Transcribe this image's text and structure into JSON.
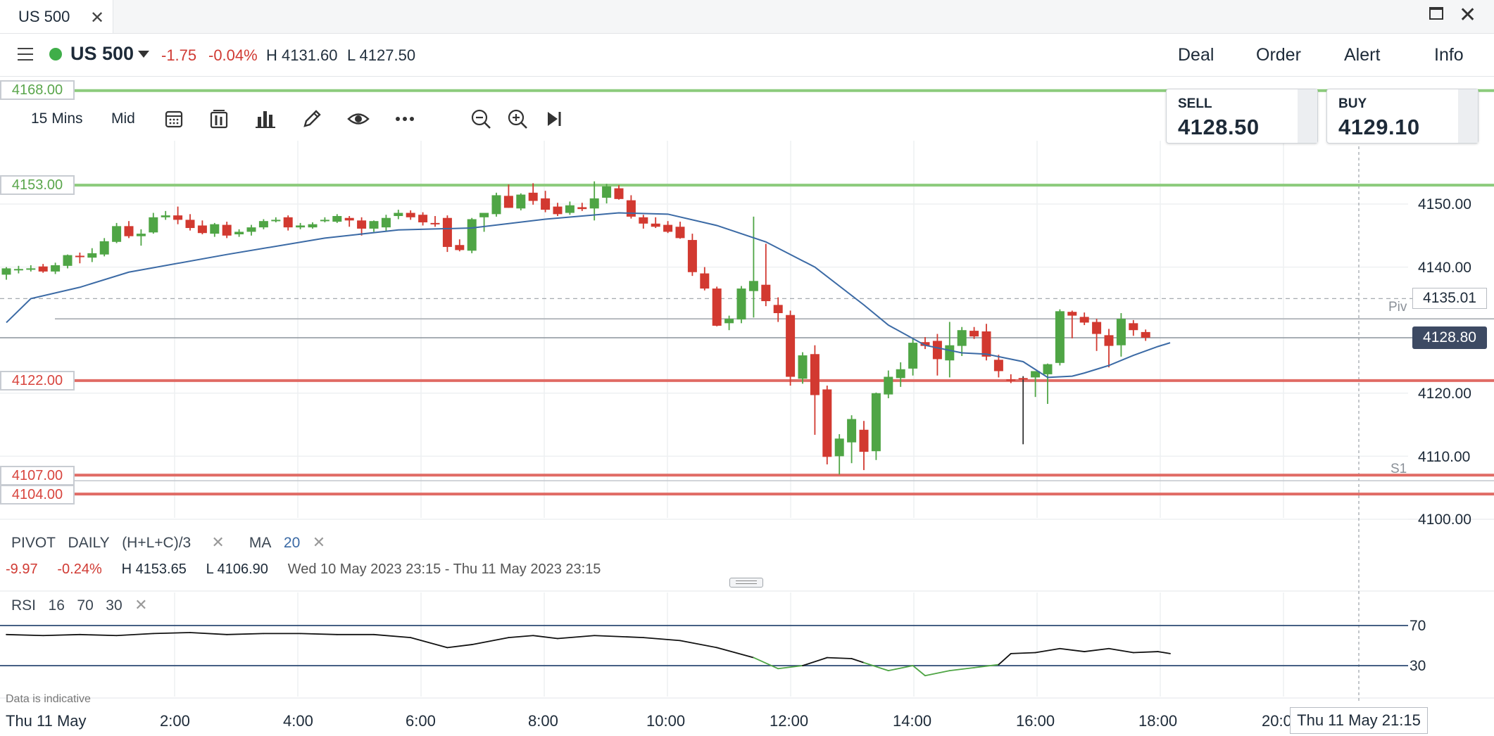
{
  "tab": {
    "title": "US 500"
  },
  "instrument": {
    "name": "US 500",
    "change": "-1.75",
    "change_pct": "-0.04%",
    "high": "H 4131.60",
    "low": "L 4127.50"
  },
  "top_actions": [
    "Deal",
    "Order",
    "Alert",
    "Info"
  ],
  "toolbar": {
    "interval": "15 Mins",
    "price_type": "Mid"
  },
  "sell": {
    "label": "SELL",
    "price": "4128.50"
  },
  "buy": {
    "label": "BUY",
    "price": "4129.10"
  },
  "level_labels": {
    "r1": "4168.00",
    "r2": "4153.00",
    "s_a": "4122.00",
    "s_b": "4107.00",
    "s_c": "4104.00"
  },
  "price_markers": {
    "reference": "4135.01",
    "current": "4128.80",
    "pivot_tag": "Piv",
    "s1_tag": "S1"
  },
  "y_axis_labels": [
    "4150.00",
    "4140.00",
    "4120.00",
    "4110.00",
    "4100.00"
  ],
  "indicators": {
    "pivot_label": "PIVOT",
    "pivot_period": "DAILY",
    "pivot_formula": "(H+L+C)/3",
    "ma_label": "MA",
    "ma_period": "20",
    "summary_change": "-9.97",
    "summary_change_pct": "-0.24%",
    "summary_high": "H 4153.65",
    "summary_low": "L 4106.90",
    "summary_range": "Wed 10 May 2023 23:15 - Thu 11 May 2023 23:15"
  },
  "rsi": {
    "label": "RSI",
    "period": "16",
    "upper": "70",
    "lower": "30",
    "upper_tick": "70",
    "lower_tick": "30"
  },
  "x_axis": {
    "date_label": "Thu 11 May",
    "labels": [
      "2:00",
      "4:00",
      "6:00",
      "8:00",
      "10:00",
      "12:00",
      "14:00",
      "16:00",
      "18:00",
      "20:0"
    ],
    "cursor_time": "Thu 11 May 21:15"
  },
  "footer": {
    "note": "Data is indicative"
  },
  "colors": {
    "up": "#4fa545",
    "down": "#d23930",
    "ma": "#3b6aa5",
    "resistance_line": "#8ccb7c",
    "support_line": "#e06b65",
    "rsi_line": "#111111",
    "rsi_oversold": "#4fa545",
    "rsi_bands": "#2c4a73",
    "price_box": "#3d4a63"
  },
  "chart_data": [
    {
      "type": "candlestick",
      "title": "US 500",
      "interval": "15 Mins",
      "ylim": [
        4096,
        4172
      ],
      "x_ticks": [
        "2:00",
        "4:00",
        "6:00",
        "8:00",
        "10:00",
        "12:00",
        "14:00",
        "16:00",
        "18:00",
        "20:0"
      ],
      "candles": [
        {
          "o": 4138.8,
          "h": 4140.0,
          "l": 4138.0,
          "c": 4139.8
        },
        {
          "o": 4139.6,
          "h": 4140.2,
          "l": 4139.0,
          "c": 4139.7
        },
        {
          "o": 4139.7,
          "h": 4140.3,
          "l": 4139.3,
          "c": 4139.8
        },
        {
          "o": 4140.1,
          "h": 4140.5,
          "l": 4139.1,
          "c": 4139.3
        },
        {
          "o": 4139.3,
          "h": 4140.7,
          "l": 4138.9,
          "c": 4140.3
        },
        {
          "o": 4140.2,
          "h": 4142.0,
          "l": 4139.8,
          "c": 4141.9
        },
        {
          "o": 4141.8,
          "h": 4142.3,
          "l": 4140.6,
          "c": 4141.6
        },
        {
          "o": 4141.5,
          "h": 4143.0,
          "l": 4140.8,
          "c": 4142.2
        },
        {
          "o": 4142.0,
          "h": 4144.6,
          "l": 4141.7,
          "c": 4144.1
        },
        {
          "o": 4144.0,
          "h": 4147.0,
          "l": 4143.8,
          "c": 4146.5
        },
        {
          "o": 4146.5,
          "h": 4147.3,
          "l": 4144.6,
          "c": 4144.9
        },
        {
          "o": 4144.9,
          "h": 4146.0,
          "l": 4143.4,
          "c": 4145.3
        },
        {
          "o": 4145.5,
          "h": 4148.6,
          "l": 4145.3,
          "c": 4147.9
        },
        {
          "o": 4147.9,
          "h": 4148.9,
          "l": 4147.5,
          "c": 4148.2
        },
        {
          "o": 4148.2,
          "h": 4149.6,
          "l": 4146.8,
          "c": 4147.5
        },
        {
          "o": 4147.5,
          "h": 4148.4,
          "l": 4145.8,
          "c": 4146.2
        },
        {
          "o": 4146.6,
          "h": 4147.4,
          "l": 4145.2,
          "c": 4145.4
        },
        {
          "o": 4145.3,
          "h": 4147.0,
          "l": 4144.8,
          "c": 4146.8
        },
        {
          "o": 4146.7,
          "h": 4147.2,
          "l": 4144.6,
          "c": 4145.0
        },
        {
          "o": 4145.2,
          "h": 4146.0,
          "l": 4144.8,
          "c": 4145.6
        },
        {
          "o": 4145.6,
          "h": 4146.7,
          "l": 4145.0,
          "c": 4146.3
        },
        {
          "o": 4146.3,
          "h": 4147.6,
          "l": 4146.0,
          "c": 4147.3
        },
        {
          "o": 4147.4,
          "h": 4147.9,
          "l": 4147.1,
          "c": 4147.5
        },
        {
          "o": 4147.9,
          "h": 4148.2,
          "l": 4145.8,
          "c": 4146.3
        },
        {
          "o": 4146.3,
          "h": 4147.0,
          "l": 4146.0,
          "c": 4146.6
        },
        {
          "o": 4146.3,
          "h": 4147.1,
          "l": 4146.1,
          "c": 4146.8
        },
        {
          "o": 4147.3,
          "h": 4147.9,
          "l": 4147.1,
          "c": 4147.5
        },
        {
          "o": 4147.2,
          "h": 4148.4,
          "l": 4147.0,
          "c": 4148.1
        },
        {
          "o": 4147.8,
          "h": 4148.1,
          "l": 4146.4,
          "c": 4147.4
        },
        {
          "o": 4147.4,
          "h": 4147.9,
          "l": 4145.0,
          "c": 4146.1
        },
        {
          "o": 4146.1,
          "h": 4147.4,
          "l": 4145.6,
          "c": 4147.3
        },
        {
          "o": 4146.3,
          "h": 4148.3,
          "l": 4145.6,
          "c": 4147.8
        },
        {
          "o": 4148.1,
          "h": 4149.1,
          "l": 4147.6,
          "c": 4148.6
        },
        {
          "o": 4148.6,
          "h": 4149.0,
          "l": 4147.5,
          "c": 4147.9
        },
        {
          "o": 4148.3,
          "h": 4148.7,
          "l": 4146.6,
          "c": 4147.1
        },
        {
          "o": 4147.0,
          "h": 4148.1,
          "l": 4146.4,
          "c": 4146.8
        },
        {
          "o": 4147.8,
          "h": 4148.2,
          "l": 4142.4,
          "c": 4143.2
        },
        {
          "o": 4143.5,
          "h": 4144.4,
          "l": 4142.5,
          "c": 4142.7
        },
        {
          "o": 4142.6,
          "h": 4147.8,
          "l": 4142.2,
          "c": 4147.6
        },
        {
          "o": 4147.9,
          "h": 4148.5,
          "l": 4145.6,
          "c": 4148.6
        },
        {
          "o": 4148.4,
          "h": 4151.8,
          "l": 4148.0,
          "c": 4151.4
        },
        {
          "o": 4151.3,
          "h": 4153.1,
          "l": 4149.4,
          "c": 4149.4
        },
        {
          "o": 4149.3,
          "h": 4151.7,
          "l": 4149.0,
          "c": 4151.5
        },
        {
          "o": 4151.8,
          "h": 4153.3,
          "l": 4149.9,
          "c": 4150.5
        },
        {
          "o": 4150.9,
          "h": 4152.1,
          "l": 4148.7,
          "c": 4149.1
        },
        {
          "o": 4149.6,
          "h": 4150.2,
          "l": 4148.1,
          "c": 4148.4
        },
        {
          "o": 4148.6,
          "h": 4150.4,
          "l": 4148.3,
          "c": 4149.8
        },
        {
          "o": 4149.5,
          "h": 4150.2,
          "l": 4148.9,
          "c": 4149.2
        },
        {
          "o": 4149.3,
          "h": 4153.6,
          "l": 4147.4,
          "c": 4150.9
        },
        {
          "o": 4151.0,
          "h": 4153.2,
          "l": 4150.1,
          "c": 4152.8
        },
        {
          "o": 4152.5,
          "h": 4153.0,
          "l": 4150.7,
          "c": 4150.8
        },
        {
          "o": 4150.6,
          "h": 4151.4,
          "l": 4147.7,
          "c": 4148.0
        },
        {
          "o": 4147.9,
          "h": 4148.3,
          "l": 4146.1,
          "c": 4146.9
        },
        {
          "o": 4146.9,
          "h": 4147.9,
          "l": 4146.2,
          "c": 4146.4
        },
        {
          "o": 4146.7,
          "h": 4147.3,
          "l": 4145.4,
          "c": 4145.6
        },
        {
          "o": 4146.4,
          "h": 4147.2,
          "l": 4144.5,
          "c": 4144.6
        },
        {
          "o": 4144.3,
          "h": 4145.3,
          "l": 4138.6,
          "c": 4139.2
        },
        {
          "o": 4139.0,
          "h": 4140.0,
          "l": 4136.3,
          "c": 4136.6
        },
        {
          "o": 4136.6,
          "h": 4136.9,
          "l": 4130.6,
          "c": 4130.7
        },
        {
          "o": 4131.1,
          "h": 4132.3,
          "l": 4130.0,
          "c": 4131.8
        },
        {
          "o": 4131.7,
          "h": 4137.0,
          "l": 4131.1,
          "c": 4136.6
        },
        {
          "o": 4136.2,
          "h": 4148.0,
          "l": 4132.0,
          "c": 4137.8
        },
        {
          "o": 4137.2,
          "h": 4143.7,
          "l": 4133.8,
          "c": 4134.6
        },
        {
          "o": 4134.0,
          "h": 4135.2,
          "l": 4131.3,
          "c": 4132.7
        },
        {
          "o": 4132.4,
          "h": 4133.1,
          "l": 4121.2,
          "c": 4122.6
        },
        {
          "o": 4122.3,
          "h": 4126.5,
          "l": 4121.5,
          "c": 4126.0
        },
        {
          "o": 4126.2,
          "h": 4127.6,
          "l": 4113.4,
          "c": 4119.7
        },
        {
          "o": 4120.6,
          "h": 4121.2,
          "l": 4108.7,
          "c": 4109.9
        },
        {
          "o": 4110.0,
          "h": 4113.5,
          "l": 4107.1,
          "c": 4112.8
        },
        {
          "o": 4112.2,
          "h": 4116.5,
          "l": 4108.9,
          "c": 4115.9
        },
        {
          "o": 4114.2,
          "h": 4115.6,
          "l": 4107.8,
          "c": 4110.7
        },
        {
          "o": 4110.8,
          "h": 4120.1,
          "l": 4109.4,
          "c": 4120.0
        },
        {
          "o": 4119.8,
          "h": 4123.6,
          "l": 4119.2,
          "c": 4122.6
        },
        {
          "o": 4122.4,
          "h": 4124.9,
          "l": 4121.0,
          "c": 4123.8
        },
        {
          "o": 4123.9,
          "h": 4128.6,
          "l": 4122.8,
          "c": 4128.0
        },
        {
          "o": 4128.1,
          "h": 4128.9,
          "l": 4127.0,
          "c": 4127.5
        },
        {
          "o": 4128.3,
          "h": 4129.4,
          "l": 4122.8,
          "c": 4125.4
        },
        {
          "o": 4125.2,
          "h": 4131.3,
          "l": 4122.5,
          "c": 4127.6
        },
        {
          "o": 4127.5,
          "h": 4130.5,
          "l": 4125.9,
          "c": 4130.0
        },
        {
          "o": 4129.9,
          "h": 4130.5,
          "l": 4128.6,
          "c": 4129.0
        },
        {
          "o": 4129.8,
          "h": 4131.0,
          "l": 4125.2,
          "c": 4125.8
        },
        {
          "o": 4125.3,
          "h": 4126.1,
          "l": 4122.5,
          "c": 4123.5
        },
        {
          "o": 4122.2,
          "h": 4123.0,
          "l": 4121.6,
          "c": 4122.0
        },
        {
          "o": 4122.4,
          "h": 4122.7,
          "l": 4111.9,
          "c": 4122.2
        },
        {
          "o": 4122.5,
          "h": 4123.1,
          "l": 4119.4,
          "c": 4123.5
        },
        {
          "o": 4123.0,
          "h": 4124.7,
          "l": 4118.3,
          "c": 4124.6
        },
        {
          "o": 4124.8,
          "h": 4133.3,
          "l": 4124.4,
          "c": 4133.0
        },
        {
          "o": 4132.9,
          "h": 4133.1,
          "l": 4128.7,
          "c": 4132.3
        },
        {
          "o": 4132.1,
          "h": 4132.8,
          "l": 4130.8,
          "c": 4131.2
        },
        {
          "o": 4131.3,
          "h": 4131.8,
          "l": 4126.7,
          "c": 4129.4
        },
        {
          "o": 4129.2,
          "h": 4130.2,
          "l": 4124.1,
          "c": 4127.5
        },
        {
          "o": 4127.6,
          "h": 4132.7,
          "l": 4125.8,
          "c": 4131.8
        },
        {
          "o": 4131.1,
          "h": 4131.6,
          "l": 4129.1,
          "c": 4130.0
        },
        {
          "o": 4129.7,
          "h": 4130.1,
          "l": 4128.3,
          "c": 4128.8
        }
      ],
      "moving_average": {
        "name": "MA 20",
        "points": [
          [
            0,
            4131.2
          ],
          [
            2,
            4135.0
          ],
          [
            6,
            4136.8
          ],
          [
            10,
            4139.2
          ],
          [
            18,
            4142.0
          ],
          [
            26,
            4144.6
          ],
          [
            32,
            4145.9
          ],
          [
            38,
            4146.2
          ],
          [
            44,
            4147.6
          ],
          [
            50,
            4148.6
          ],
          [
            54,
            4148.4
          ],
          [
            58,
            4146.6
          ],
          [
            62,
            4144.0
          ],
          [
            66,
            4140.0
          ],
          [
            70,
            4134.0
          ],
          [
            72,
            4130.8
          ],
          [
            75,
            4127.6
          ],
          [
            78,
            4126.4
          ],
          [
            80,
            4126.2
          ],
          [
            83,
            4125.0
          ],
          [
            85,
            4122.5
          ],
          [
            87,
            4122.7
          ],
          [
            88,
            4123.2
          ],
          [
            90,
            4124.4
          ],
          [
            92,
            4126.0
          ],
          [
            94,
            4127.4
          ],
          [
            95,
            4128.0
          ]
        ]
      },
      "horizontal_levels": [
        {
          "value": 4168.0,
          "kind": "resistance",
          "label": "4168.00"
        },
        {
          "value": 4153.0,
          "kind": "resistance",
          "label": "4153.00"
        },
        {
          "value": 4122.0,
          "kind": "support",
          "label": "4122.00"
        },
        {
          "value": 4107.0,
          "kind": "support",
          "label": "4107.00"
        },
        {
          "value": 4104.0,
          "kind": "support",
          "label": "4104.00"
        },
        {
          "value": 4131.8,
          "kind": "pivot",
          "label": "Piv"
        },
        {
          "value": 4135.01,
          "kind": "reference",
          "label": "4135.01"
        },
        {
          "value": 4128.8,
          "kind": "current",
          "label": "4128.80"
        }
      ],
      "y_ticks": [
        4150,
        4140,
        4120,
        4110,
        4100
      ]
    },
    {
      "type": "line",
      "title": "RSI 16 70 30",
      "ylim": [
        0,
        100
      ],
      "y_ticks": [
        70,
        30
      ],
      "points": [
        [
          0,
          61
        ],
        [
          3,
          60
        ],
        [
          6,
          61
        ],
        [
          9,
          60
        ],
        [
          12,
          62
        ],
        [
          15,
          63
        ],
        [
          18,
          61
        ],
        [
          21,
          62
        ],
        [
          24,
          62
        ],
        [
          27,
          61
        ],
        [
          30,
          61
        ],
        [
          33,
          58
        ],
        [
          36,
          48
        ],
        [
          38,
          51
        ],
        [
          41,
          58
        ],
        [
          43,
          60
        ],
        [
          45,
          57
        ],
        [
          48,
          60
        ],
        [
          52,
          58
        ],
        [
          55,
          55
        ],
        [
          58,
          48
        ],
        [
          61,
          38
        ],
        [
          63,
          27
        ],
        [
          65,
          30
        ],
        [
          67,
          38
        ],
        [
          69,
          37
        ],
        [
          70,
          33
        ],
        [
          72,
          25
        ],
        [
          74,
          30
        ],
        [
          75,
          20
        ],
        [
          77,
          25
        ],
        [
          79,
          28
        ],
        [
          81,
          31
        ],
        [
          82,
          42
        ],
        [
          84,
          43
        ],
        [
          86,
          47
        ],
        [
          88,
          44
        ],
        [
          90,
          47
        ],
        [
          91,
          45
        ],
        [
          92,
          43
        ],
        [
          94,
          44
        ],
        [
          95,
          42
        ]
      ]
    }
  ]
}
